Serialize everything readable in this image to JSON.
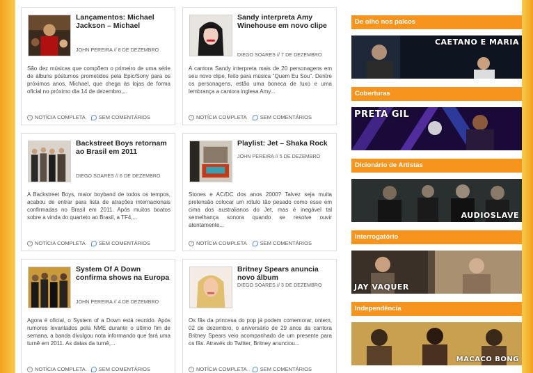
{
  "posts": [
    {
      "title": "Lançamentos: Michael Jackson – Michael",
      "meta": "JOHN PEREIRA // 8 DE DEZEMBRO",
      "excerpt": "São dez músicas que compõem o primeiro de uma série de álbuns póstumos prometidos pela Epic/Sony para os próximos anos. Michael, que chega às lojas de forma oficial no próximo dia 14 de dezembro,...",
      "more": "NOTÍCIA COMPLETA",
      "comments": "SEM COMENTÁRIOS"
    },
    {
      "title": "Sandy interpreta Amy Winehouse em novo clipe",
      "meta": "DIEGO SOARES // 7 DE DEZEMBRO",
      "excerpt": "A cantora Sandy interpreta mais de 20 personagens em seu novo clipe, feito para música \"Quem Eu Sou\". Dentre os personagens, estão uma boneca de luxo e uma lembrança a cantora inglesa Amy...",
      "more": "NOTÍCIA COMPLETA",
      "comments": "SEM COMENTÁRIOS"
    },
    {
      "title": "Backstreet Boys retornam ao Brasil em 2011",
      "meta": "DIEGO SOARES // 6 DE DEZEMBRO",
      "excerpt": "A Backstreet Boys, maior boyband de todos os tempos, acabou de entrar para lista de atrações internacionais confirmadas no Brasil em 2011. Após muitos boatos sobre a vinda do quarteto ao Brasil, a TF4,...",
      "more": "NOTÍCIA COMPLETA",
      "comments": "SEM COMENTÁRIOS"
    },
    {
      "title": "Playlist: Jet – Shaka Rock",
      "meta": "JOHN PEREIRA // 5 DE DEZEMBRO",
      "excerpt": "Stones e AC/DC dos anos 2000? Talvez seja muita pretensão colocar um rótulo tão pesado como esse em cima dos australianos do Jet, mas é inegável tal semelhança sonora quando se resolve ouvir atentamente...",
      "more": "NOTÍCIA COMPLETA",
      "comments": "SEM COMENTÁRIOS"
    },
    {
      "title": "System Of A Down confirma shows na Europa",
      "meta": "JOHN PEREIRA // 4 DE DEZEMBRO",
      "excerpt": "Agora é oficial, o System of a Down está reunido. Após rumores levantados pela NME durante o último fim de semana, a banda divulgou nota informando que fará uma turnê em 2011. As datas da turnê,...",
      "more": "NOTÍCIA COMPLETA",
      "comments": "SEM COMENTÁRIOS"
    },
    {
      "title": "Britney Spears anuncia novo álbum",
      "meta": "DIEGO SOARES // 3 DE DEZEMBRO",
      "excerpt": "Os fãs da princesa do pop já podem comemorar, ontem, 02 de dezembro, o aniversário de 29 anos da cantora Britney Spears veio acompanhado de um presente para os fãs. Através do Twitter, Britney anunciou...",
      "more": "NOTÍCIA COMPLETA",
      "comments": "SEM COMENTÁRIOS"
    }
  ],
  "sidebar": [
    {
      "heading": "De olho nos palcos",
      "banner": "CAETANO E MARIA"
    },
    {
      "heading": "Coberturas",
      "banner": "PRETA GIL"
    },
    {
      "heading": "Dicionário de Artistas",
      "banner": "AUDIOSLAVE"
    },
    {
      "heading": "Interrogatório",
      "banner": "JAY VAQUER"
    },
    {
      "heading": "Independência",
      "banner": "MACACO BONG"
    }
  ],
  "colors": {
    "accent": "#f7941d",
    "background": "#f7c542"
  },
  "icons": {
    "more": "circle-arrow-icon",
    "comments": "speech-bubble-icon"
  }
}
